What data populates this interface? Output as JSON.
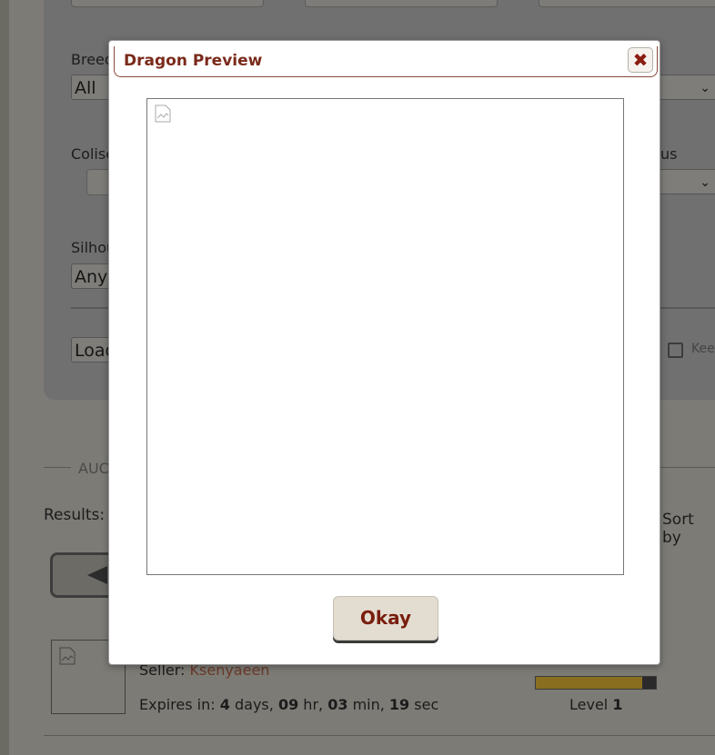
{
  "filters": {
    "breed_label": "Breed",
    "breed_value": "All",
    "coliseum_label": "Coliseum",
    "status_label_fragment": "us",
    "silhouette_label": "Silhouette",
    "silhouette_value": "Any",
    "load_button": "Load",
    "keep_label": "Kee"
  },
  "auction": {
    "section_label": "AUC",
    "results_label": "Results:",
    "sort_label": "Sort by"
  },
  "listing": {
    "seller_prefix": "Seller:",
    "seller_name": "Ksenyaeen",
    "expires_prefix": "Expires in:",
    "days_value": "4",
    "days_unit": "days,",
    "hours_value": "09",
    "hours_unit": "hr,",
    "minutes_value": "03",
    "minutes_unit": "min,",
    "seconds_value": "19",
    "seconds_unit": "sec",
    "level_label": "Level",
    "level_value": "1",
    "xp_fraction": 0.89
  },
  "modal": {
    "title": "Dragon Preview",
    "close_icon": "close-icon",
    "okay_label": "Okay"
  },
  "colors": {
    "modal_title": "#7a2a1a",
    "close_x": "#8b1c10",
    "okay_text": "#7a1e0e",
    "seller_name": "#6b3a2a"
  }
}
